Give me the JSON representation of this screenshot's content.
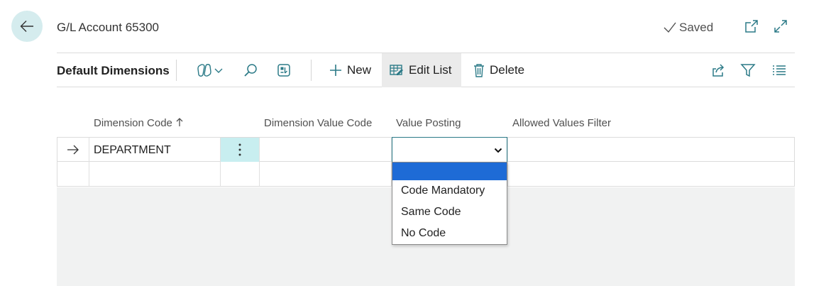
{
  "header": {
    "title": "G/L Account 65300",
    "status": "Saved"
  },
  "toolbar": {
    "part_title": "Default Dimensions",
    "new_label": "New",
    "edit_list_label": "Edit List",
    "delete_label": "Delete"
  },
  "columns": {
    "dimension_code": "Dimension Code",
    "dimension_value_code": "Dimension Value Code",
    "value_posting": "Value Posting",
    "allowed_values_filter": "Allowed Values Filter"
  },
  "rows": [
    {
      "dimension_code": "DEPARTMENT",
      "dimension_value_code": "",
      "value_posting": "",
      "allowed_values_filter": ""
    },
    {
      "dimension_code": "",
      "dimension_value_code": "",
      "value_posting": "",
      "allowed_values_filter": ""
    }
  ],
  "value_posting_options": [
    "",
    "Code Mandatory",
    "Same Code",
    "No Code"
  ],
  "colors": {
    "accent": "#2b7a87",
    "back_button_bg": "#d5ecee",
    "row_menu_bg": "#c8eef0",
    "selected_option": "#1e6bd6"
  }
}
